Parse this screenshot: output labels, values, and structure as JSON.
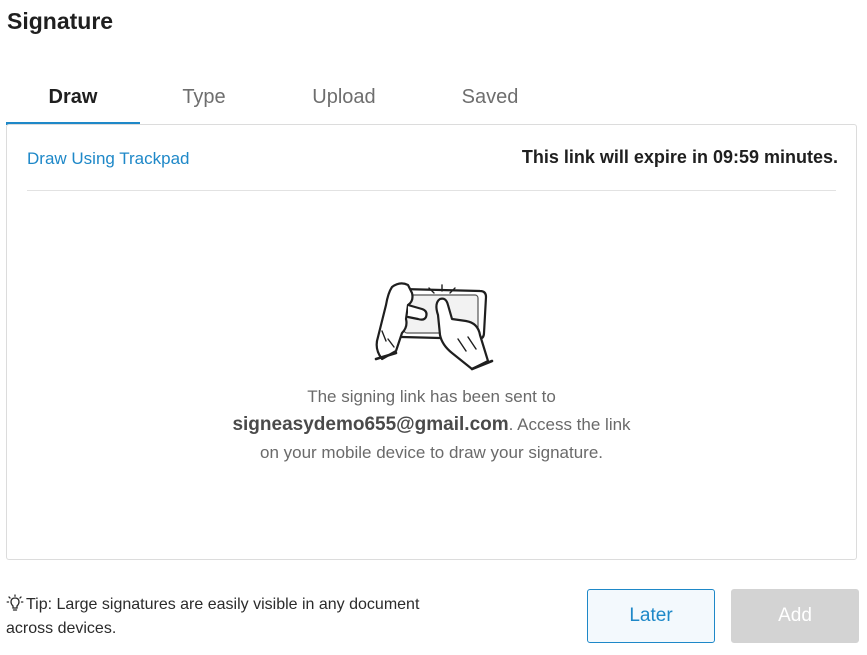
{
  "dialog": {
    "title": "Signature"
  },
  "tabs": [
    {
      "label": "Draw",
      "active": true
    },
    {
      "label": "Type",
      "active": false
    },
    {
      "label": "Upload",
      "active": false
    },
    {
      "label": "Saved",
      "active": false
    }
  ],
  "panel": {
    "trackpad_link": "Draw Using Trackpad",
    "expire_text": "This link will expire in 09:59 minutes.",
    "illustration_icon": "hands-phone-icon",
    "message_line1": "The signing link has been sent to",
    "email": "signeasydemo655@gmail.com",
    "message_line2_suffix": ". Access the link",
    "message_line3": "on your mobile device to draw your signature."
  },
  "footer": {
    "tip_icon": "lightbulb-icon",
    "tip_line1": "Tip: Large signatures are easily visible in any document",
    "tip_line2": "across devices.",
    "later_label": "Later",
    "add_label": "Add"
  },
  "colors": {
    "accent": "#1e88c8",
    "disabled_button": "#d3d3d3",
    "border": "#dcdcdc"
  }
}
